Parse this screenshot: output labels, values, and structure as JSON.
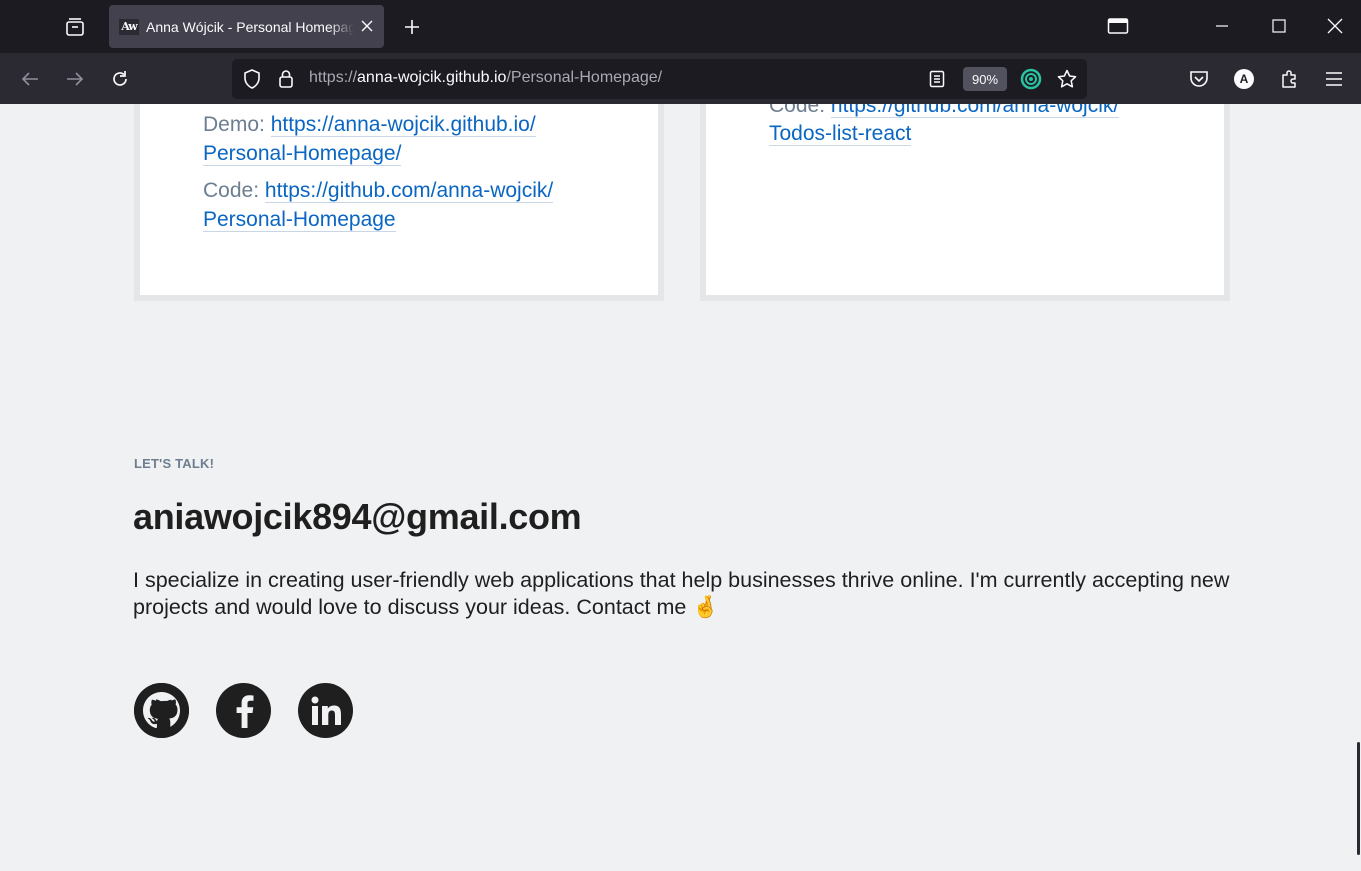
{
  "browser": {
    "tab": {
      "favicon_text": "Aw",
      "title": "Anna Wójcik - Personal Homepage"
    },
    "url": {
      "prefix": "https://",
      "domain": "anna-wojcik.github.io",
      "path": "/Personal-Homepage/"
    },
    "zoom": "90%",
    "account_initial": "A",
    "icons": [
      "tab-list-icon",
      "close-icon",
      "plus-icon",
      "minimize-icon",
      "maximize-icon",
      "window-close-icon",
      "back-icon",
      "forward-icon",
      "reload-icon",
      "shield-icon",
      "lock-icon",
      "reader-view-icon",
      "extension-ring-icon",
      "star-icon",
      "pocket-icon",
      "extensions-icon",
      "menu-icon",
      "picture-in-picture-icon"
    ]
  },
  "projects": {
    "left": {
      "demo_label": "Demo:",
      "demo_link_1": "https://anna-wojcik.github.io/",
      "demo_link_2": "Personal-Homepage/",
      "code_label": "Code:",
      "code_link_1": "https://github.com/anna-wojcik/",
      "code_link_2": "Personal-Homepage"
    },
    "right": {
      "code_label": "Code:",
      "code_link_1": "https://github.com/anna-wojcik/",
      "code_link_2": "Todos-list-react"
    }
  },
  "contact": {
    "subtitle": "LET'S TALK!",
    "email": "aniawojcik894@gmail.com",
    "description": "I specialize in creating user-friendly web applications that help businesses thrive online. I'm currently accepting new projects and would love to discuss your ideas. Contact me 🤞"
  },
  "socials": [
    {
      "icon": "github-icon"
    },
    {
      "icon": "facebook-icon"
    },
    {
      "icon": "linkedin-icon"
    }
  ]
}
